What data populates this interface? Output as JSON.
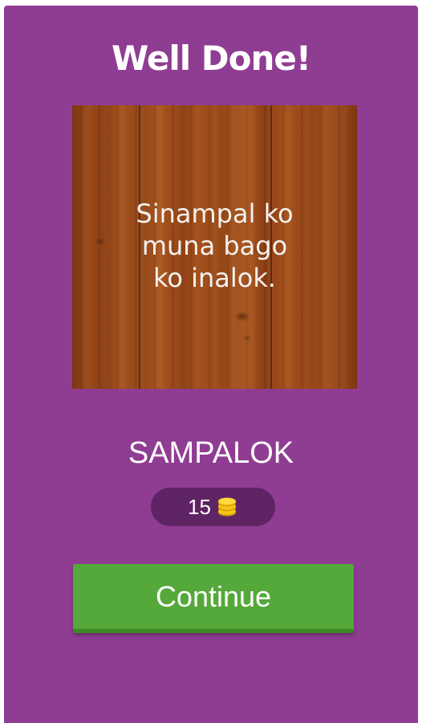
{
  "dialog": {
    "title": "Well Done!"
  },
  "riddle": {
    "text": "Sinampal ko\nmuna bago\nko inalok."
  },
  "answer": {
    "word": "SAMPALOK"
  },
  "reward": {
    "amount": "15",
    "icon": "coins-icon"
  },
  "actions": {
    "continue_label": "Continue"
  },
  "colors": {
    "panel": "#8f3c93",
    "reward_pill": "#5e2463",
    "continue_button": "#55a83a",
    "coin": "#f5c518"
  }
}
